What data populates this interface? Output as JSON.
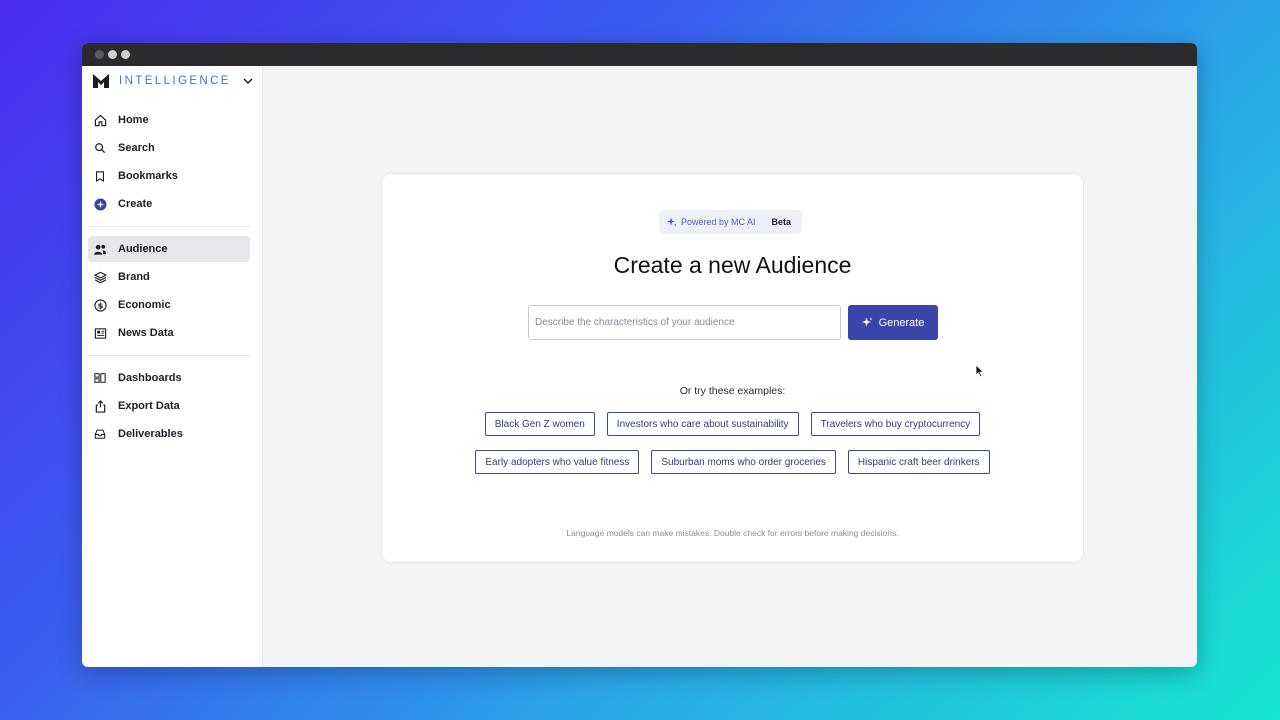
{
  "window": {
    "controls": [
      "close",
      "minimize",
      "maximize"
    ]
  },
  "brand": {
    "name": "INTELLIGENCE",
    "logo_icon": "m-logo-icon",
    "accent": "#3a7ab8"
  },
  "sidebar": {
    "group1": [
      {
        "label": "Home",
        "icon": "home-icon"
      },
      {
        "label": "Search",
        "icon": "search-icon"
      },
      {
        "label": "Bookmarks",
        "icon": "bookmark-icon"
      },
      {
        "label": "Create",
        "icon": "plus-circle-icon"
      }
    ],
    "group2": [
      {
        "label": "Audience",
        "icon": "people-icon",
        "active": true
      },
      {
        "label": "Brand",
        "icon": "layers-icon"
      },
      {
        "label": "Economic",
        "icon": "dollar-circle-icon"
      },
      {
        "label": "News Data",
        "icon": "newspaper-icon"
      }
    ],
    "group3": [
      {
        "label": "Dashboards",
        "icon": "dashboard-icon"
      },
      {
        "label": "Export Data",
        "icon": "export-icon"
      },
      {
        "label": "Deliverables",
        "icon": "inbox-icon"
      }
    ]
  },
  "main": {
    "badge": {
      "powered": "Powered by MC AI",
      "beta": "Beta"
    },
    "title": "Create a new Audience",
    "prompt": {
      "placeholder": "Describe the characteristics of your audience",
      "value": ""
    },
    "generate_label": "Generate",
    "examples_label": "Or try these examples:",
    "examples_row1": [
      "Black Gen Z women",
      "Investors who care about sustainability",
      "Travelers who buy cryptocurrency"
    ],
    "examples_row2": [
      "Early adopters who value fitness",
      "Suburban moms who order groceries",
      "Hispanic craft beer drinkers"
    ],
    "disclaimer": "Language models can make mistakes. Double check for errors before making decisions."
  },
  "colors": {
    "primary_button": "#3a44a9",
    "chip_border": "#3a4a8e",
    "active_nav_bg": "#e6e7ea"
  }
}
